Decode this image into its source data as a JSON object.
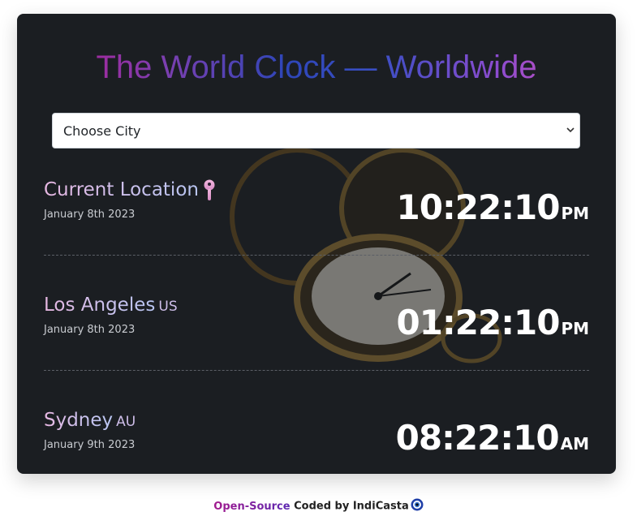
{
  "title": "The World Clock — Worldwide",
  "city_select": {
    "value": "Choose City"
  },
  "clocks": [
    {
      "city": "Current Location",
      "country": "",
      "date": "January 8th 2023",
      "time": "10:22:10",
      "ampm": "PM"
    },
    {
      "city": "Los Angeles",
      "country": "US",
      "date": "January 8th 2023",
      "time": "01:22:10",
      "ampm": "PM"
    },
    {
      "city": "Sydney",
      "country": "AU",
      "date": "January 9th 2023",
      "time": "08:22:10",
      "ampm": "AM"
    }
  ],
  "footer": {
    "open_source": "Open-Source",
    "rest": " Coded by IndiCasta"
  },
  "icons": {
    "pin": "map-pin-icon",
    "chevron": "chevron-down-icon",
    "eye": "evil-eye-icon"
  },
  "colors": {
    "card_bg": "#1b1e22",
    "title_start": "#c2188e",
    "title_mid": "#2e46b8",
    "title_end": "#e453b6"
  }
}
